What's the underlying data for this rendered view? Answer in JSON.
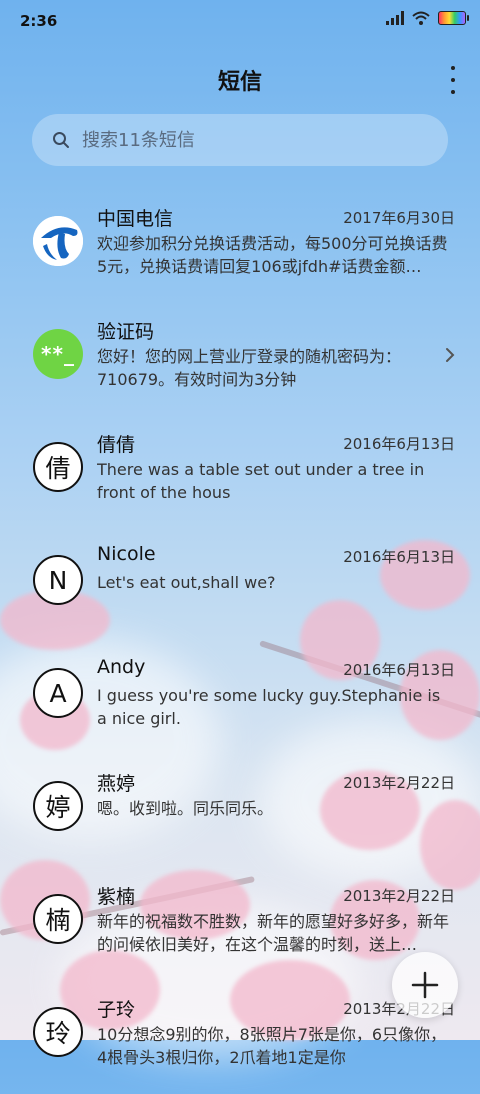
{
  "status": {
    "time": "2:36"
  },
  "header": {
    "title": "短信"
  },
  "search": {
    "placeholder": "搜索11条短信"
  },
  "conversations": [
    {
      "avatar": "",
      "avatar_type": "telecom-logo",
      "name": "中国电信",
      "date": "2017年6月30日",
      "snippet": "欢迎参加积分兑换话费活动，每500分可兑换话费5元，兑换话费请回复106或jfdh#话费金额…"
    },
    {
      "avatar": "**_",
      "avatar_type": "code",
      "name": "验证码",
      "date": "",
      "snippet": "您好！您的网上营业厅登录的随机密码为：710679。有效时间为3分钟"
    },
    {
      "avatar": "倩",
      "avatar_type": "letter",
      "name": "倩倩",
      "date": "2016年6月13日",
      "snippet": "There was a table set out under a tree in front of the hous"
    },
    {
      "avatar": "N",
      "avatar_type": "letter",
      "name": "Nicole",
      "date": "2016年6月13日",
      "snippet": "Let's eat out,shall we?"
    },
    {
      "avatar": "A",
      "avatar_type": "letter",
      "name": "Andy",
      "date": "2016年6月13日",
      "snippet": "I guess you're some lucky guy.Stephanie is a nice girl."
    },
    {
      "avatar": "婷",
      "avatar_type": "letter",
      "name": "燕婷",
      "date": "2013年2月22日",
      "snippet": "嗯。收到啦。同乐同乐。"
    },
    {
      "avatar": "楠",
      "avatar_type": "letter",
      "name": "紫楠",
      "date": "2013年2月22日",
      "snippet": "新年的祝福数不胜数，新年的愿望好多好多，新年的问候依旧美好，在这个温馨的时刻，送上…"
    },
    {
      "avatar": "玲",
      "avatar_type": "letter",
      "name": "子玲",
      "date": "2013年2月22日",
      "snippet": "10分想念9别的你，8张照片7张是你，6只像你，4根骨头3根归你，2爪着地1定是你"
    }
  ],
  "icons": {
    "search": "search-icon",
    "more": "more-vertical-icon",
    "chevron": "chevron-right-icon",
    "fab": "plus-icon"
  },
  "colors": {
    "code_avatar": "#6fd444",
    "telecom_blue": "#1565c0"
  }
}
